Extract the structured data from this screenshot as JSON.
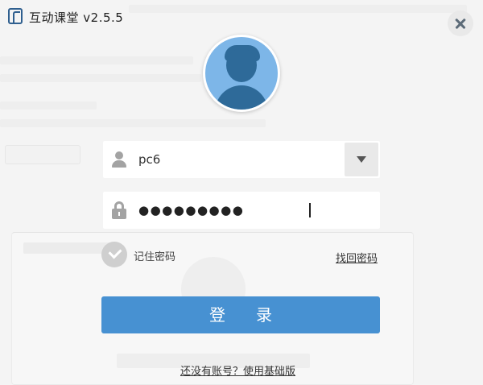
{
  "window": {
    "title": "互动课堂 v2.5.5",
    "close_icon": "close-icon"
  },
  "login": {
    "username": "pc6",
    "password_masked": "●●●●●●●●●",
    "remember_label": "记住密码",
    "remember_checked": false,
    "forgot_label": "找回密码",
    "login_label": "登录",
    "register_label": "还没有账号？使用基础版"
  },
  "icons": {
    "avatar": "user-avatar-icon",
    "user": "user-icon",
    "lock": "lock-icon",
    "dropdown": "chevron-down-icon",
    "check": "check-icon"
  },
  "colors": {
    "primary": "#4791d2",
    "avatar_bg": "#7db6e8",
    "avatar_figure": "#2e6a99"
  }
}
